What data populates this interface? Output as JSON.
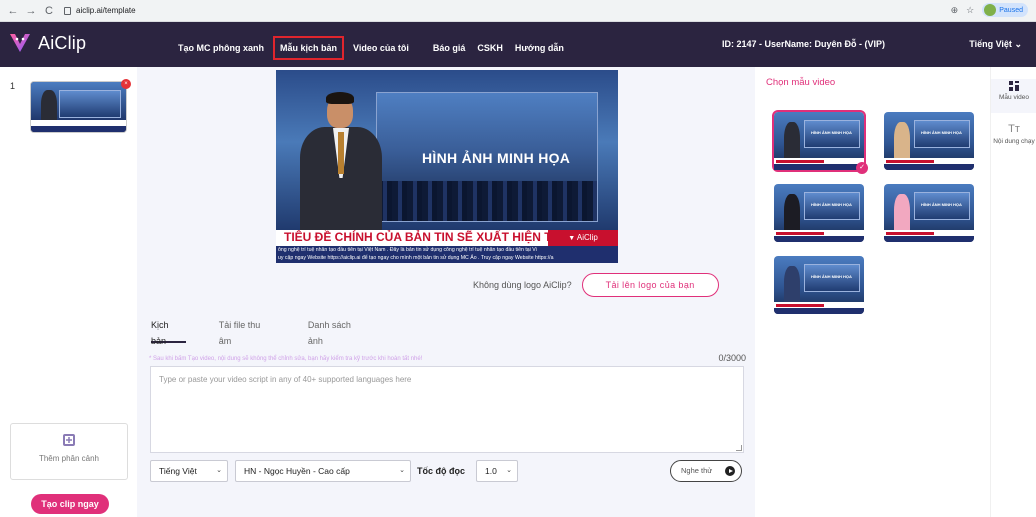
{
  "browser": {
    "url": "aiclip.ai/template",
    "profile_status": "Paused"
  },
  "header": {
    "logo_text": "AiClip",
    "nav": [
      {
        "label": "Tạo MC phông xanh"
      },
      {
        "label": "Mẫu kịch bản",
        "active": true
      },
      {
        "label": "Video của tôi"
      },
      {
        "label": "Báo giá"
      },
      {
        "label": "CSKH"
      },
      {
        "label": "Hướng dẫn"
      }
    ],
    "user_info": "ID: 2147 - UserName: Duyên Đỗ - (VIP)",
    "language": "Tiếng Việt"
  },
  "left_panel": {
    "scene_number": "1",
    "scene_badge": "×",
    "add_scene_label": "Thêm phân cảnh",
    "create_button": "Tạo clip ngay"
  },
  "preview": {
    "heading": "HÌNH ẢNH MINH HỌA",
    "title": "TIÊU ĐỀ CHÍNH CỦA BẢN TIN SẼ XUẤT HIỆN TẠI ĐÂY",
    "brand": "AiClip",
    "ticker_line1": "ông nghệ trí tuệ nhân tạo đầu tiên tại Việt Nam . Đây là bản tin sử dụng công nghệ trí tuệ nhân tạo đầu tiên tại Vi",
    "ticker_line2": "uy cập ngay Website https://aiclip.ai để tạo ngay cho mình một bản tin sử dụng MC Ảo . Truy cập ngay Website https://a"
  },
  "logo_row": {
    "hint": "Không dùng logo AiClip?",
    "upload_button": "Tải lên logo của bạn"
  },
  "tabs": [
    "Kịch bản",
    "Tải file thu âm",
    "Danh sách ảnh"
  ],
  "script": {
    "warning": "* Sau khi bấm Tạo video, nội dung sẽ không thể chỉnh sửa, bạn hãy kiểm tra kỹ trước khi hoàn tất nhé!",
    "counter": "0/3000",
    "placeholder": "Type or paste your video script in any of 40+ supported languages here"
  },
  "controls": {
    "language": "Tiếng Việt",
    "voice": "HN - Ngọc Huyền - Cao cấp",
    "speed_label": "Tốc độ đọc",
    "speed": "1.0",
    "listen_button": "Nghe thử"
  },
  "right_panel": {
    "title": "Chọn mẫu video",
    "template_text": "HÌNH ẢNH MINH HỌA",
    "selected_check": "✓",
    "templates": [
      {
        "figure": "#2a2c36",
        "selected": true
      },
      {
        "figure": "#d9b48a"
      },
      {
        "figure": "#1c1c24"
      },
      {
        "figure": "#f2a8c0"
      },
      {
        "figure": "#2e3f6b"
      }
    ]
  },
  "rail": {
    "items": [
      {
        "label": "Mẫu video",
        "active": true
      },
      {
        "label": "Nội dung chạy"
      }
    ]
  },
  "colors": {
    "header_bg": "#2b2440",
    "accent_pink": "#e0307a",
    "active_nav_border": "#e0252d",
    "panel_bg": "#f4f5fb"
  }
}
